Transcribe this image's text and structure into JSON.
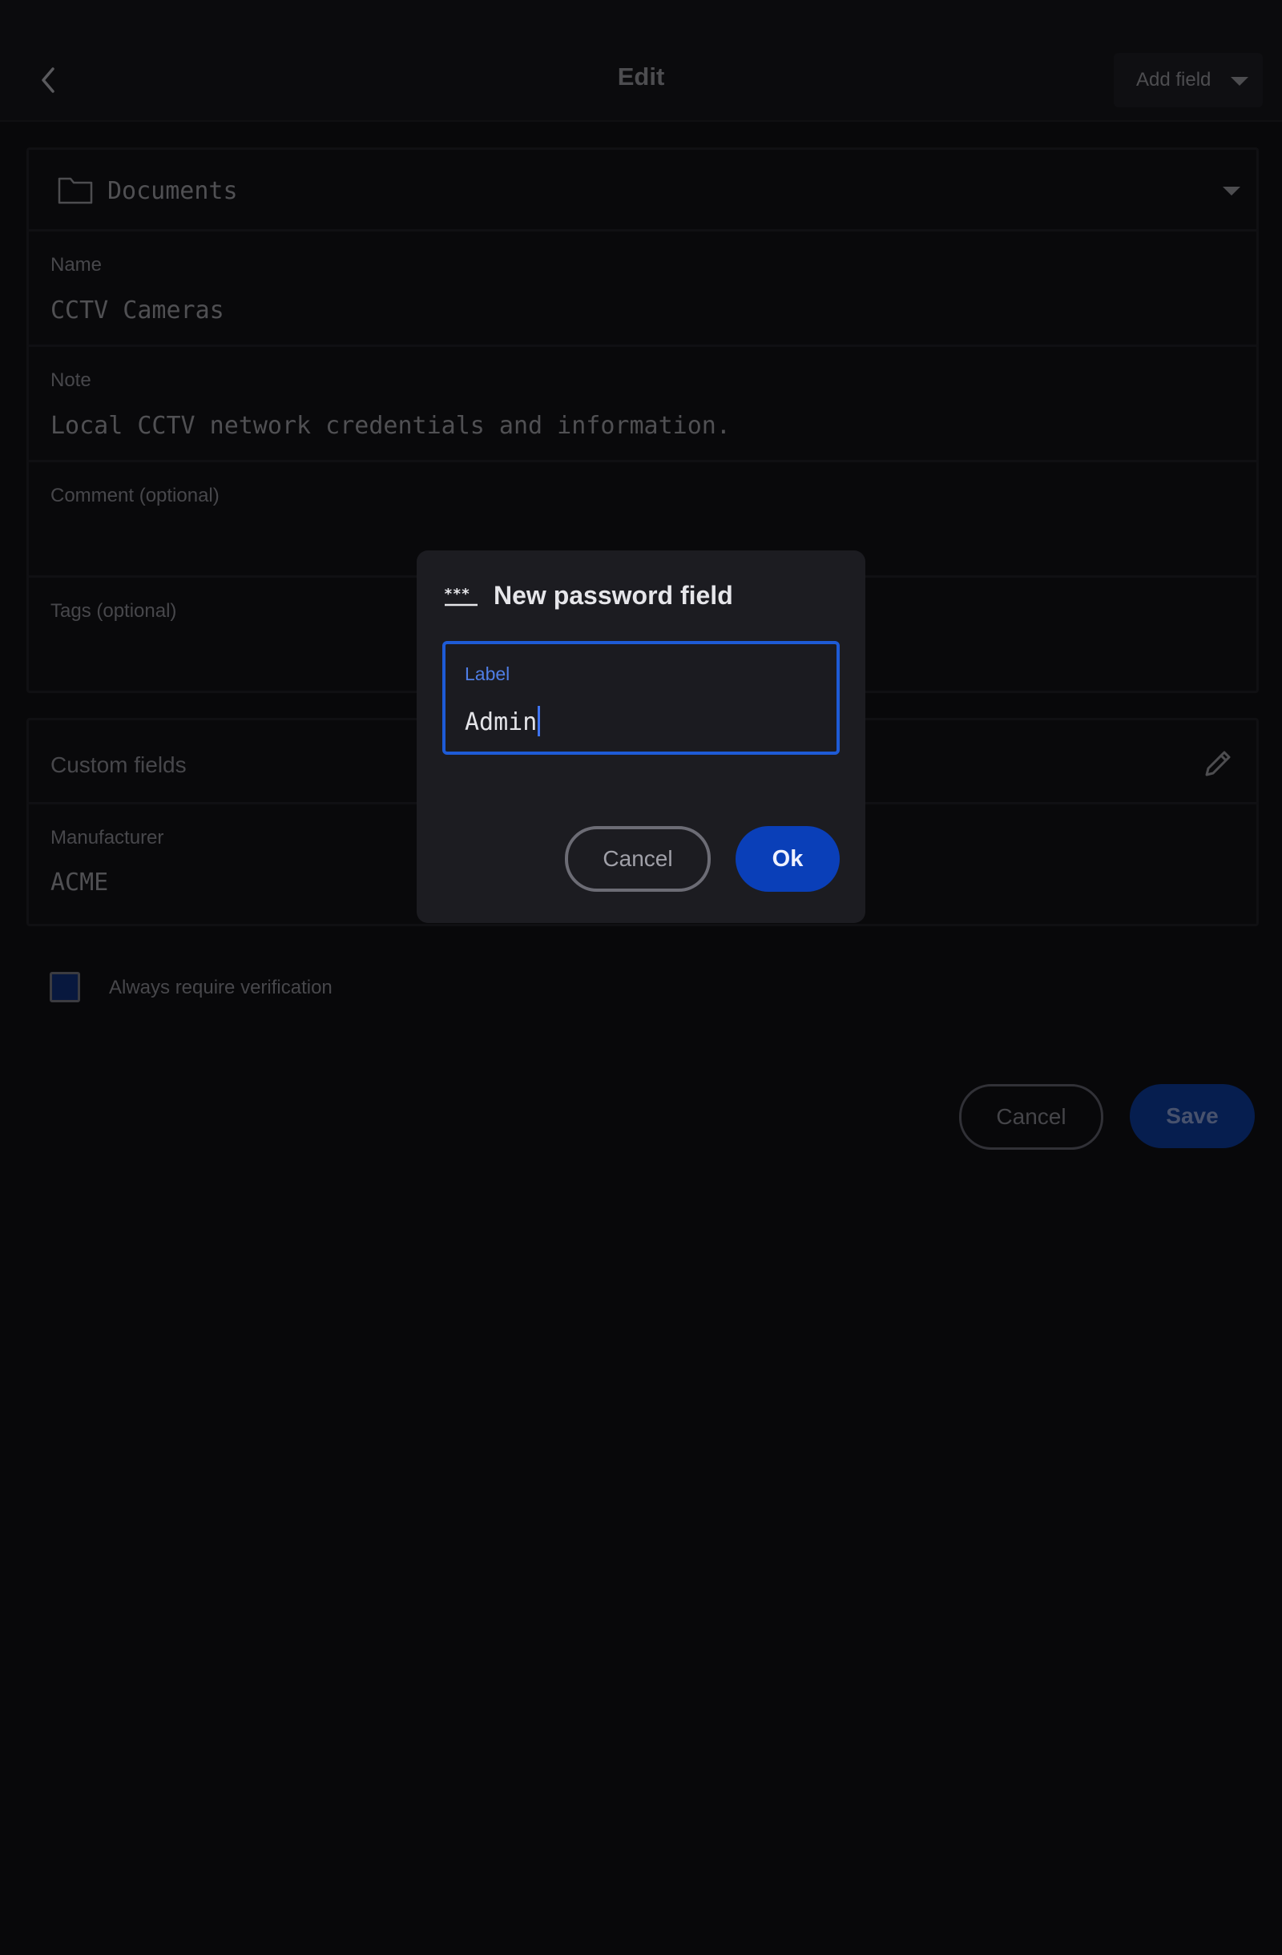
{
  "header": {
    "title": "Edit",
    "add_field_label": "Add field"
  },
  "folder": {
    "label": "Documents"
  },
  "fields": {
    "name_label": "Name",
    "name_value": "CCTV Cameras",
    "note_label": "Note",
    "note_value": "Local CCTV network credentials and information.",
    "comment_label": "Comment (optional)",
    "tags_label": "Tags (optional)"
  },
  "custom_fields": {
    "header": "Custom fields",
    "items": [
      {
        "label": "Manufacturer",
        "value": "ACME"
      }
    ]
  },
  "verification": {
    "label": "Always require verification",
    "checked": true
  },
  "footer": {
    "cancel_label": "Cancel",
    "save_label": "Save"
  },
  "dialog": {
    "title": "New password field",
    "icon_text": "***",
    "field_label": "Label",
    "field_value": "Admin",
    "cancel_label": "Cancel",
    "ok_label": "Ok"
  },
  "colors": {
    "background": "#0d0d10",
    "accent": "#1e5bd6",
    "primary_button": "#0a3fb8"
  }
}
